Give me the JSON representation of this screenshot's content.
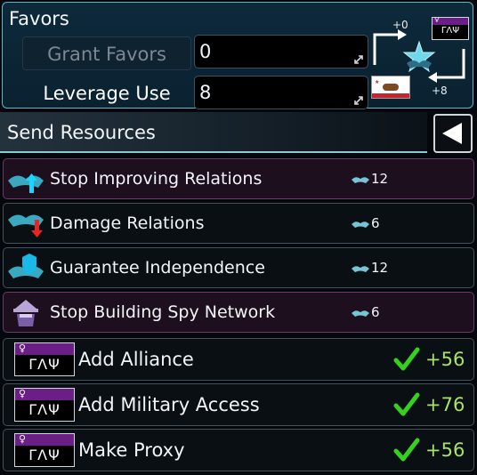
{
  "favors": {
    "title": "Favors",
    "grant_label": "Grant Favors",
    "grant_value": "0",
    "leverage_label": "Leverage Use",
    "leverage_value": "8",
    "emblem": {
      "top_value": "+0",
      "bottom_value": "+8",
      "flag_text": "ΓΛΨ",
      "flag_symbol": "♀"
    }
  },
  "send_resources": {
    "label": "Send Resources"
  },
  "actions": [
    {
      "label": "Stop Improving Relations",
      "cost": "12",
      "icon": "handshake-up-arrow-icon"
    },
    {
      "label": "Damage Relations",
      "cost": "6",
      "icon": "handshake-down-arrow-icon"
    },
    {
      "label": "Guarantee Independence",
      "cost": "12",
      "icon": "handshake-shield-icon"
    },
    {
      "label": "Stop Building Spy Network",
      "cost": "6",
      "icon": "spy-icon"
    }
  ],
  "deals": [
    {
      "label": "Add Alliance",
      "score": "+56",
      "flag_text": "ΓΛΨ",
      "flag_symbol": "♀"
    },
    {
      "label": "Add Military Access",
      "score": "+76",
      "flag_text": "ΓΛΨ",
      "flag_symbol": "♀"
    },
    {
      "label": "Make Proxy",
      "score": "+56",
      "flag_text": "ΓΛΨ",
      "flag_symbol": "♀"
    }
  ],
  "colors": {
    "accent": "#5fb7c2",
    "positive": "#a7e26a",
    "check": "#35d21d",
    "purple_row": "#1d0f1e",
    "flag_band": "#6b1f86"
  }
}
